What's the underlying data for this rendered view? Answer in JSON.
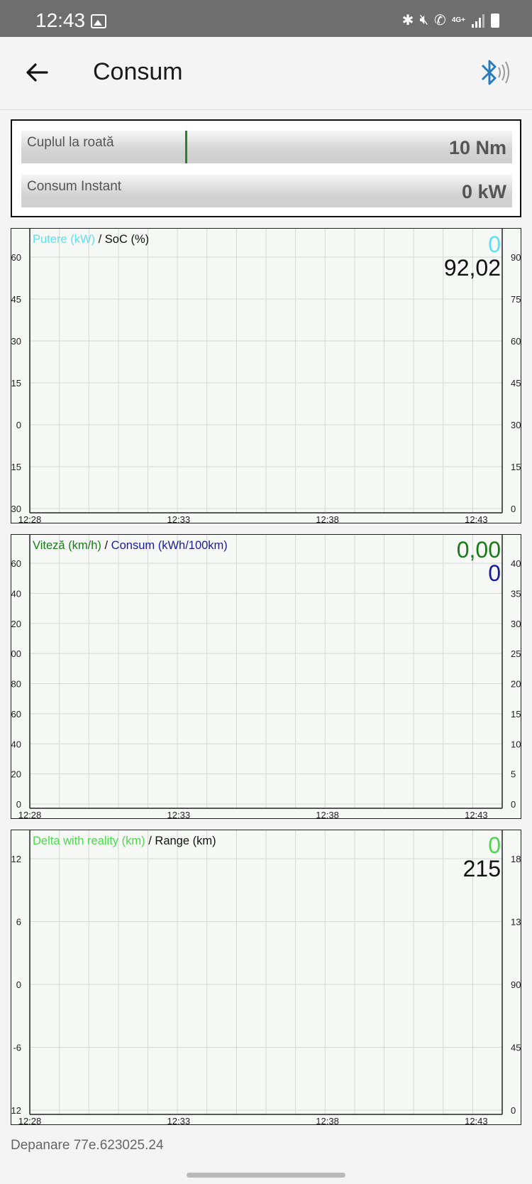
{
  "status_bar": {
    "time": "12:43",
    "network_label": "4G+",
    "icons": [
      "image-icon",
      "bluetooth-icon",
      "mute-icon",
      "wifi-call-icon",
      "signal-icon",
      "battery-icon"
    ]
  },
  "app_bar": {
    "title": "Consum",
    "back_icon": "arrow-left-icon",
    "bluetooth_icon": "bluetooth-connected-icon",
    "accent_color": "#2b7bbf"
  },
  "gauges": [
    {
      "label": "Cuplul la roată",
      "value": "10 Nm",
      "marker_color": "#1f8a1f"
    },
    {
      "label": "Consum Instant",
      "value": "0 kW"
    }
  ],
  "charts": [
    {
      "legend_primary": "Putere (kW)",
      "legend_secondary": "SoC (%)",
      "primary_color": "#5ee0f0",
      "secondary_color": "#111111",
      "current_primary": "0",
      "current_secondary": "92,02",
      "left_ticks": [
        "60",
        "45",
        "30",
        "15",
        "0",
        "15",
        "30"
      ],
      "right_ticks": [
        "90",
        "75",
        "60",
        "45",
        "30",
        "15",
        "0"
      ],
      "x_ticks": [
        "12:28",
        "12:33",
        "12:38",
        "12:43"
      ]
    },
    {
      "legend_primary": "Viteză (km/h)",
      "legend_secondary": "Consum (kWh/100km)",
      "primary_color": "#1a7a1a",
      "secondary_color": "#1a1aa0",
      "current_primary": "0,00",
      "current_secondary": "0",
      "left_ticks": [
        "60",
        "40",
        "20",
        "00",
        "80",
        "60",
        "40",
        "20",
        "0"
      ],
      "right_ticks": [
        "40",
        "35",
        "30",
        "25",
        "20",
        "15",
        "10",
        "5",
        "0"
      ],
      "x_ticks": [
        "12:28",
        "12:33",
        "12:38",
        "12:43"
      ]
    },
    {
      "legend_primary": "Delta with reality (km)",
      "legend_secondary": "Range (km)",
      "primary_color": "#4fd84f",
      "secondary_color": "#111111",
      "current_primary": "0",
      "current_secondary": "215",
      "left_ticks": [
        "12",
        "6",
        "0",
        "-6",
        "12"
      ],
      "right_ticks": [
        "18",
        "13",
        "90",
        "45",
        "0"
      ],
      "x_ticks": [
        "12:28",
        "12:33",
        "12:38",
        "12:43"
      ]
    }
  ],
  "footer": {
    "version_text": "Depanare 77e.623025.24"
  }
}
